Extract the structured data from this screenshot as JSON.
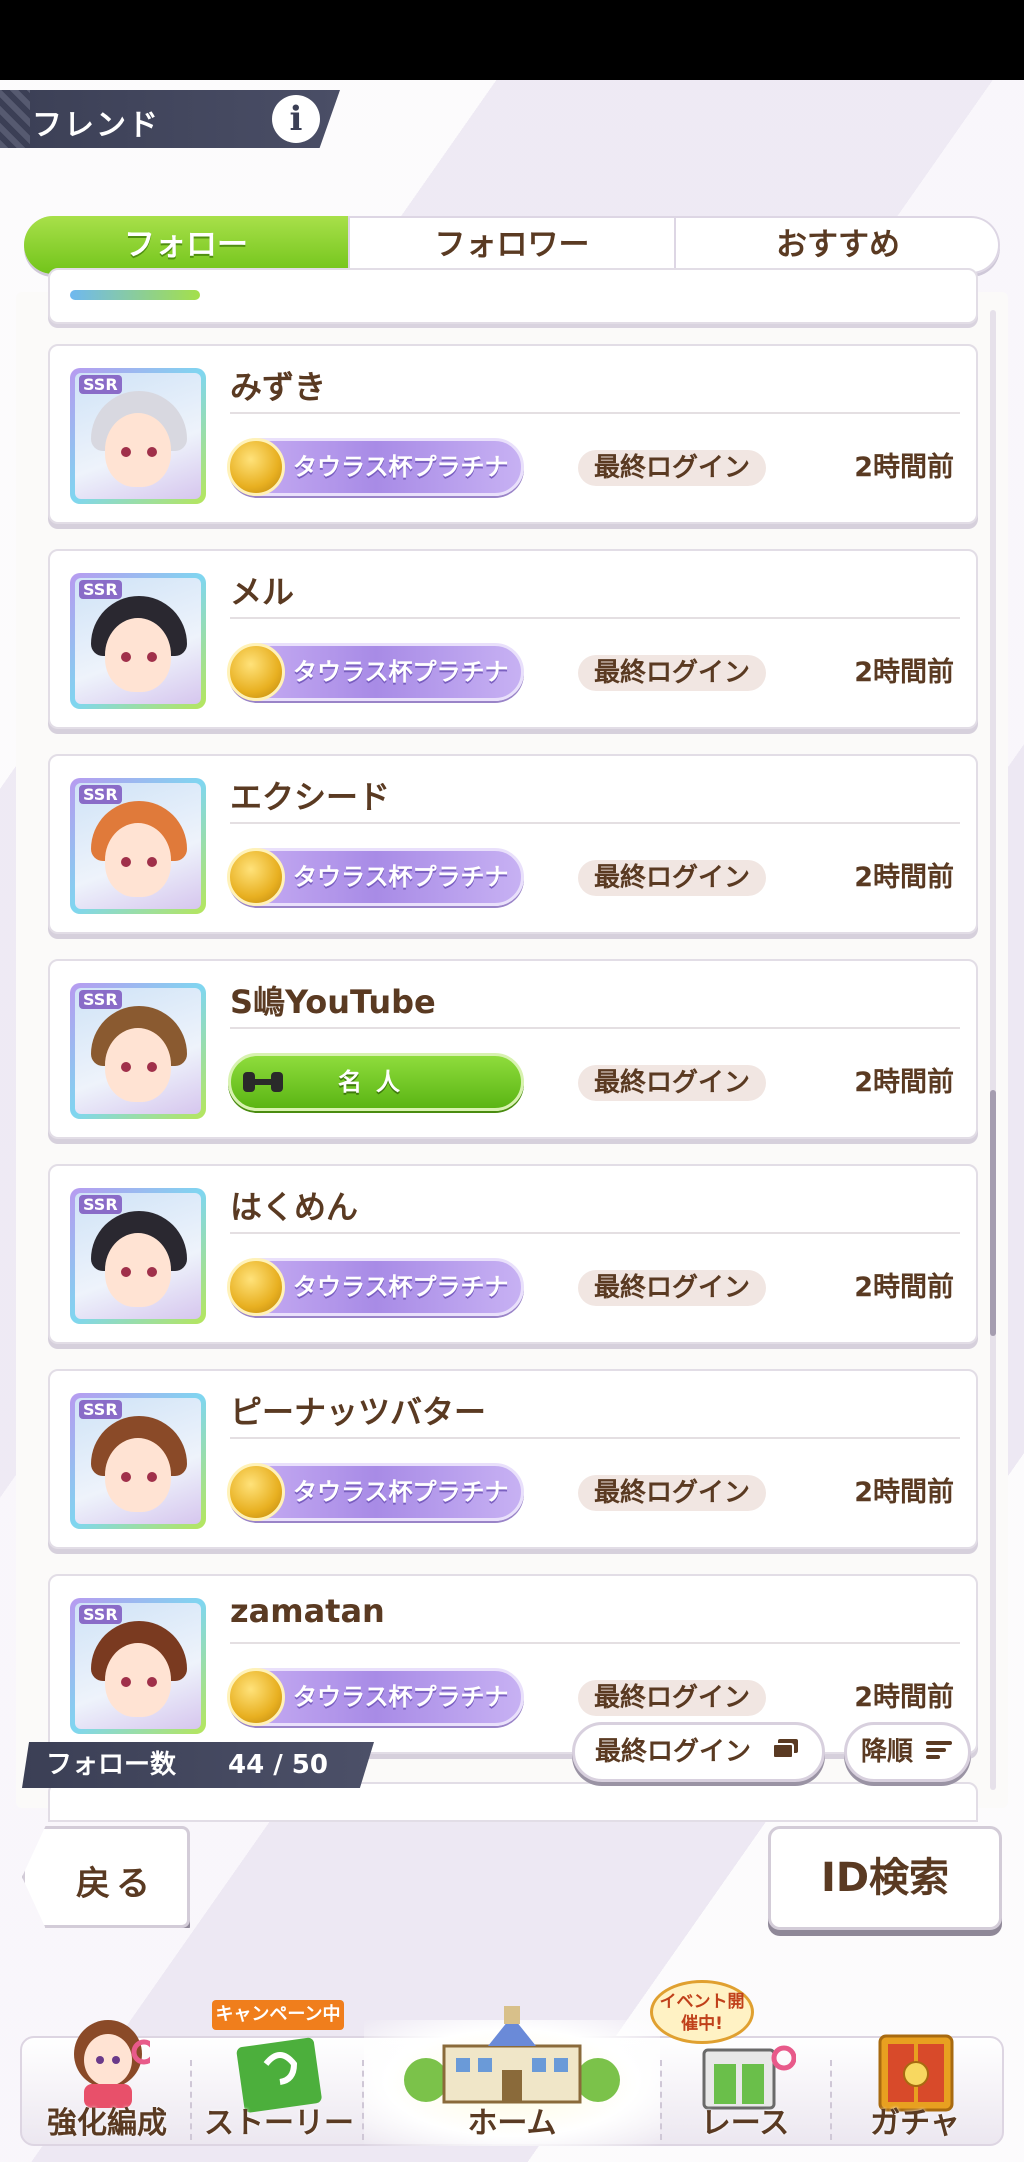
{
  "header": {
    "title": "フレンド",
    "info_icon": "i"
  },
  "tabs": [
    {
      "label": "フォロー",
      "active": true
    },
    {
      "label": "フォロワー",
      "active": false
    },
    {
      "label": "おすすめ",
      "active": false
    }
  ],
  "friends": [
    {
      "name": "みずき",
      "badge": "タウラス杯プラチナ",
      "badge_type": "platinum",
      "login_label": "最終ログイン",
      "login_time": "2時間前",
      "hair": "#d8d8e0"
    },
    {
      "name": "メル",
      "badge": "タウラス杯プラチナ",
      "badge_type": "platinum",
      "login_label": "最終ログイン",
      "login_time": "2時間前",
      "hair": "#2a2830"
    },
    {
      "name": "エクシード",
      "badge": "タウラス杯プラチナ",
      "badge_type": "platinum",
      "login_label": "最終ログイン",
      "login_time": "2時間前",
      "hair": "#e07a3a"
    },
    {
      "name": "S嶋YouTube",
      "badge": "名人",
      "badge_type": "meijin",
      "login_label": "最終ログイン",
      "login_time": "2時間前",
      "hair": "#8a5a30"
    },
    {
      "name": "はくめん",
      "badge": "タウラス杯プラチナ",
      "badge_type": "platinum",
      "login_label": "最終ログイン",
      "login_time": "2時間前",
      "hair": "#2a2830"
    },
    {
      "name": "ピーナッツバター",
      "badge": "タウラス杯プラチナ",
      "badge_type": "platinum",
      "login_label": "最終ログイン",
      "login_time": "2時間前",
      "hair": "#8a4a28"
    },
    {
      "name": "zamatan",
      "badge": "タウラス杯プラチナ",
      "badge_type": "platinum",
      "login_label": "最終ログイン",
      "login_time": "2時間前",
      "hair": "#7a3a20"
    }
  ],
  "avatar_rarity": "SSR",
  "follow_count": {
    "label": "フォロー数",
    "value": "44 / 50"
  },
  "sort": {
    "key_label": "最終ログイン",
    "order_label": "降順"
  },
  "actions": {
    "back": "戻る",
    "id_search": "ID検索"
  },
  "nav": {
    "items": [
      {
        "label": "強化編成",
        "icon": "character-icon"
      },
      {
        "label": "ストーリー",
        "icon": "book-icon"
      },
      {
        "label": "ホーム",
        "icon": "school-building-icon"
      },
      {
        "label": "レース",
        "icon": "race-gate-icon"
      },
      {
        "label": "ガチャ",
        "icon": "gacha-door-icon"
      }
    ],
    "campaign_tag": "キャンペーン中",
    "event_tag": "イベント開催中!"
  }
}
